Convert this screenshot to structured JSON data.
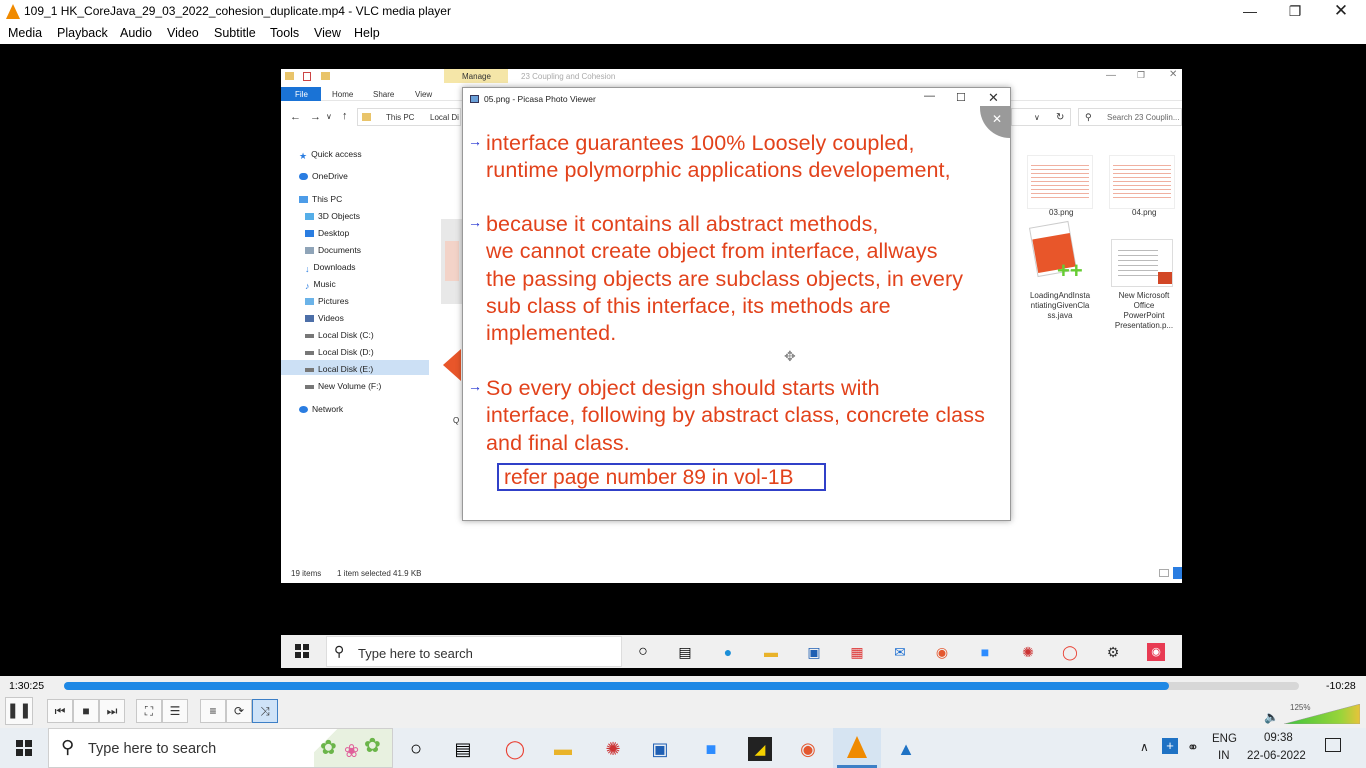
{
  "vlc": {
    "title": "109_1 HK_CoreJava_29_03_2022_cohesion_duplicate.mp4 - VLC media player",
    "menu": [
      "Media",
      "Playback",
      "Audio",
      "Video",
      "Subtitle",
      "Tools",
      "View",
      "Help"
    ],
    "time_elapsed": "1:30:25",
    "time_remaining": "-10:28",
    "progress_fraction": 0.895,
    "volume": "125%",
    "volume_fraction": 1.0,
    "accent": "#1e88e5"
  },
  "explorer": {
    "tab_manage": "Manage",
    "tab_title": "23 Coupling and Cohesion",
    "ribbon": [
      "File",
      "Home",
      "Share",
      "View"
    ],
    "address": [
      "This PC",
      "Local Di"
    ],
    "search_placeholder": "Search 23 Couplin...",
    "nav": [
      "Quick access",
      "OneDrive",
      "This PC",
      "3D Objects",
      "Desktop",
      "Documents",
      "Downloads",
      "Music",
      "Pictures",
      "Videos",
      "Local Disk (C:)",
      "Local Disk (D:)",
      "Local Disk (E:)",
      "New Volume (F:)",
      "Network"
    ],
    "files": [
      {
        "name": "03.png"
      },
      {
        "name": "04.png"
      },
      {
        "name": "LoadingAndInstantiatingGivenClass.java"
      },
      {
        "name": "New Microsoft Office PowerPoint Presentation.p..."
      }
    ],
    "file_label_lines": {
      "f3": [
        "LoadingAndInsta",
        "ntiatingGivenCla",
        "ss.java"
      ],
      "f4": [
        "New Microsoft",
        "Office",
        "PowerPoint",
        "Presentation.p..."
      ]
    },
    "partial_label": "Q",
    "status_items": "19 items",
    "status_selected": "1 item selected  41.9 KB"
  },
  "picasa": {
    "title": "05.png - Picasa Photo Viewer",
    "slide_lines": [
      "interface guarantees 100% Loosely coupled,",
      "runtime polymorphic applications developement,",
      "because it contains all abstract methods,",
      "we cannot create object from interface, allways",
      "the passing objects are subclass objects, in every",
      "sub class of this interface, its methods are",
      "implemented.",
      "So every object design should starts with",
      "interface, following by abstract class, concrete class",
      "and final class."
    ],
    "refer_text": "refer page number 89 in vol-1B",
    "text_color": "#e2421b",
    "arrow_color": "#2030d0"
  },
  "inner_taskbar": {
    "search_placeholder": "Type here to search"
  },
  "taskbar": {
    "search_placeholder": "Type here to search",
    "lang1": "ENG",
    "lang2": "IN",
    "time": "09:38",
    "date": "22-06-2022"
  }
}
